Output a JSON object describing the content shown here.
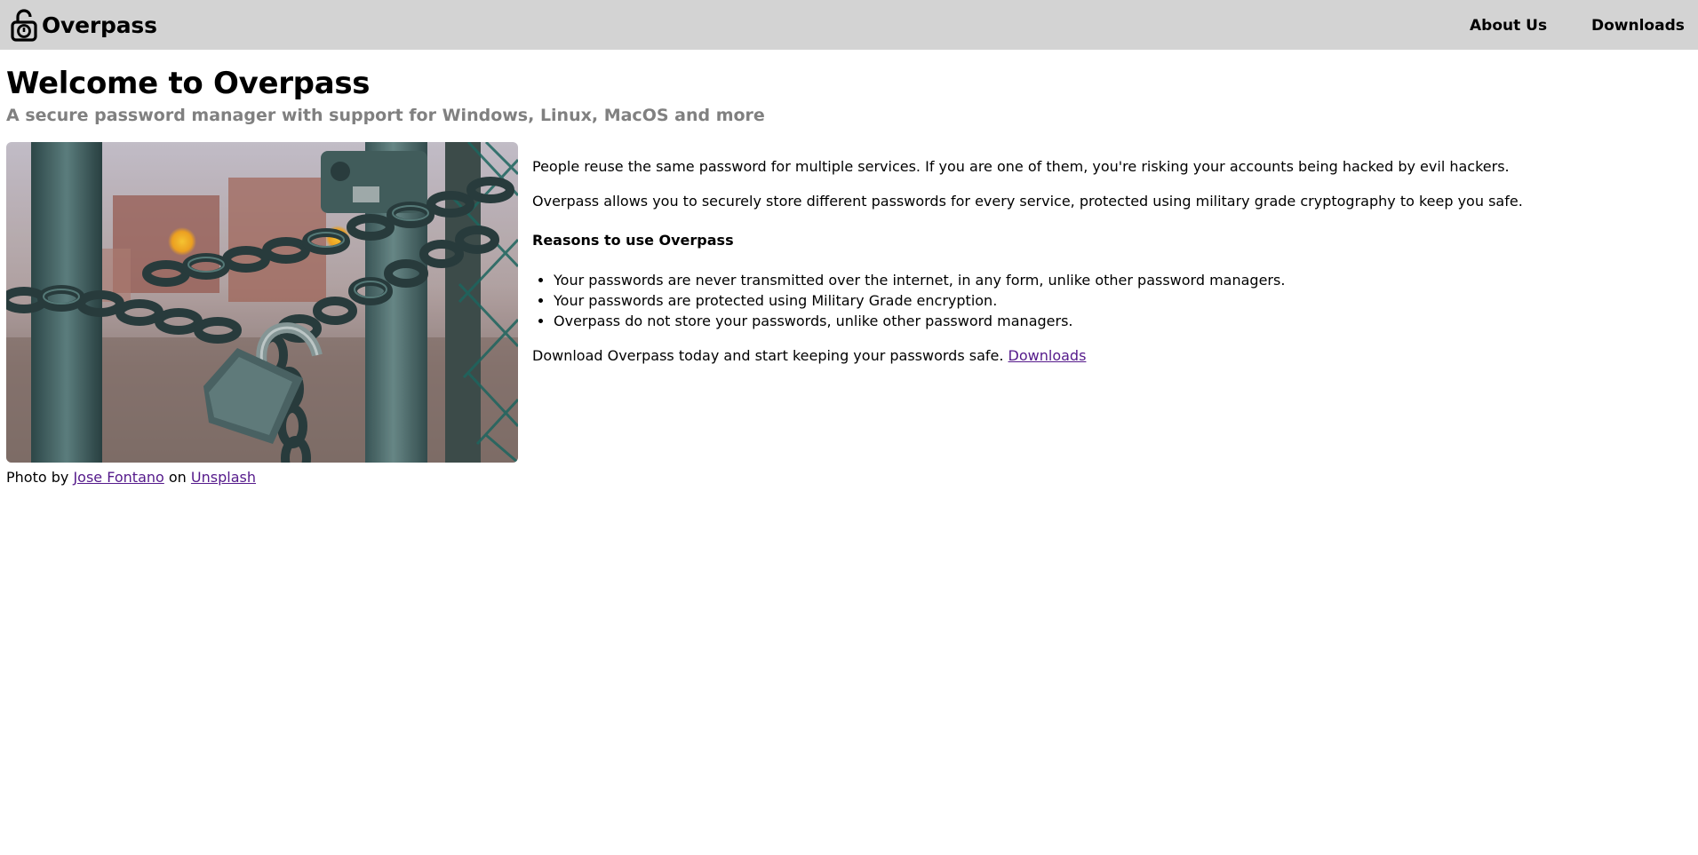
{
  "navbar": {
    "brand_name": "Overpass",
    "brand_icon": "padlock-unlocked-icon",
    "links": [
      {
        "label": "About Us"
      },
      {
        "label": "Downloads"
      }
    ],
    "background": "#d3d3d3"
  },
  "main": {
    "title": "Welcome to Overpass",
    "subtitle": "A secure password manager with support for Windows, Linux, MacOS and more",
    "paragraph1": "People reuse the same password for multiple services. If you are one of them, you're risking your accounts being hacked by evil hackers.",
    "paragraph2": "Overpass allows you to securely store different passwords for every service, protected using military grade cryptography to keep you safe.",
    "reasons_heading": "Reasons to use Overpass",
    "reasons": [
      "Your passwords are never transmitted over the internet, in any form, unlike other password managers.",
      "Your passwords are protected using Military Grade encryption.",
      "Overpass do not store your passwords, unlike other password managers."
    ],
    "download_text": "Download Overpass today and start keeping your passwords safe.",
    "download_link": "Downloads"
  },
  "image": {
    "subject": "padlock-and-chains-on-fence-photo",
    "caption_prefix": "Photo by",
    "author": "Jose Fontano",
    "caption_mid": "on",
    "source": "Unsplash"
  },
  "colors": {
    "link": "#551a8b",
    "subtitle": "#808080"
  }
}
